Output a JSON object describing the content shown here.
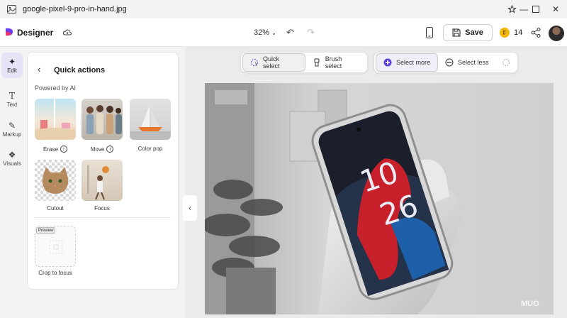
{
  "titlebar": {
    "filename": "google-pixel-9-pro-in-hand.jpg"
  },
  "appbar": {
    "brand": "Designer",
    "zoom": "32%",
    "save_label": "Save",
    "coins": "14",
    "coin_glyph": "F"
  },
  "rail": {
    "items": [
      {
        "label": "Edit"
      },
      {
        "label": "Text"
      },
      {
        "label": "Markup"
      },
      {
        "label": "Visuals"
      }
    ]
  },
  "panel": {
    "title": "Quick actions",
    "powered_by": "Powered by AI",
    "tiles": [
      {
        "label": "Erase"
      },
      {
        "label": "Move"
      },
      {
        "label": "Color pop"
      },
      {
        "label": "Cutout"
      },
      {
        "label": "Focus"
      }
    ],
    "preview": {
      "badge": "Preview",
      "label": "Crop to focus"
    }
  },
  "toolbar": {
    "quick_select": "Quick select",
    "brush_select": "Brush select",
    "select_more": "Select more",
    "select_less": "Select less"
  },
  "photo": {
    "clock_hour": "10",
    "clock_minute": "26",
    "watermark": "MUO"
  },
  "colors": {
    "accent": "#5b3fd6",
    "rail_active": "#e7e3f7",
    "phone_red": "#c8202a"
  }
}
